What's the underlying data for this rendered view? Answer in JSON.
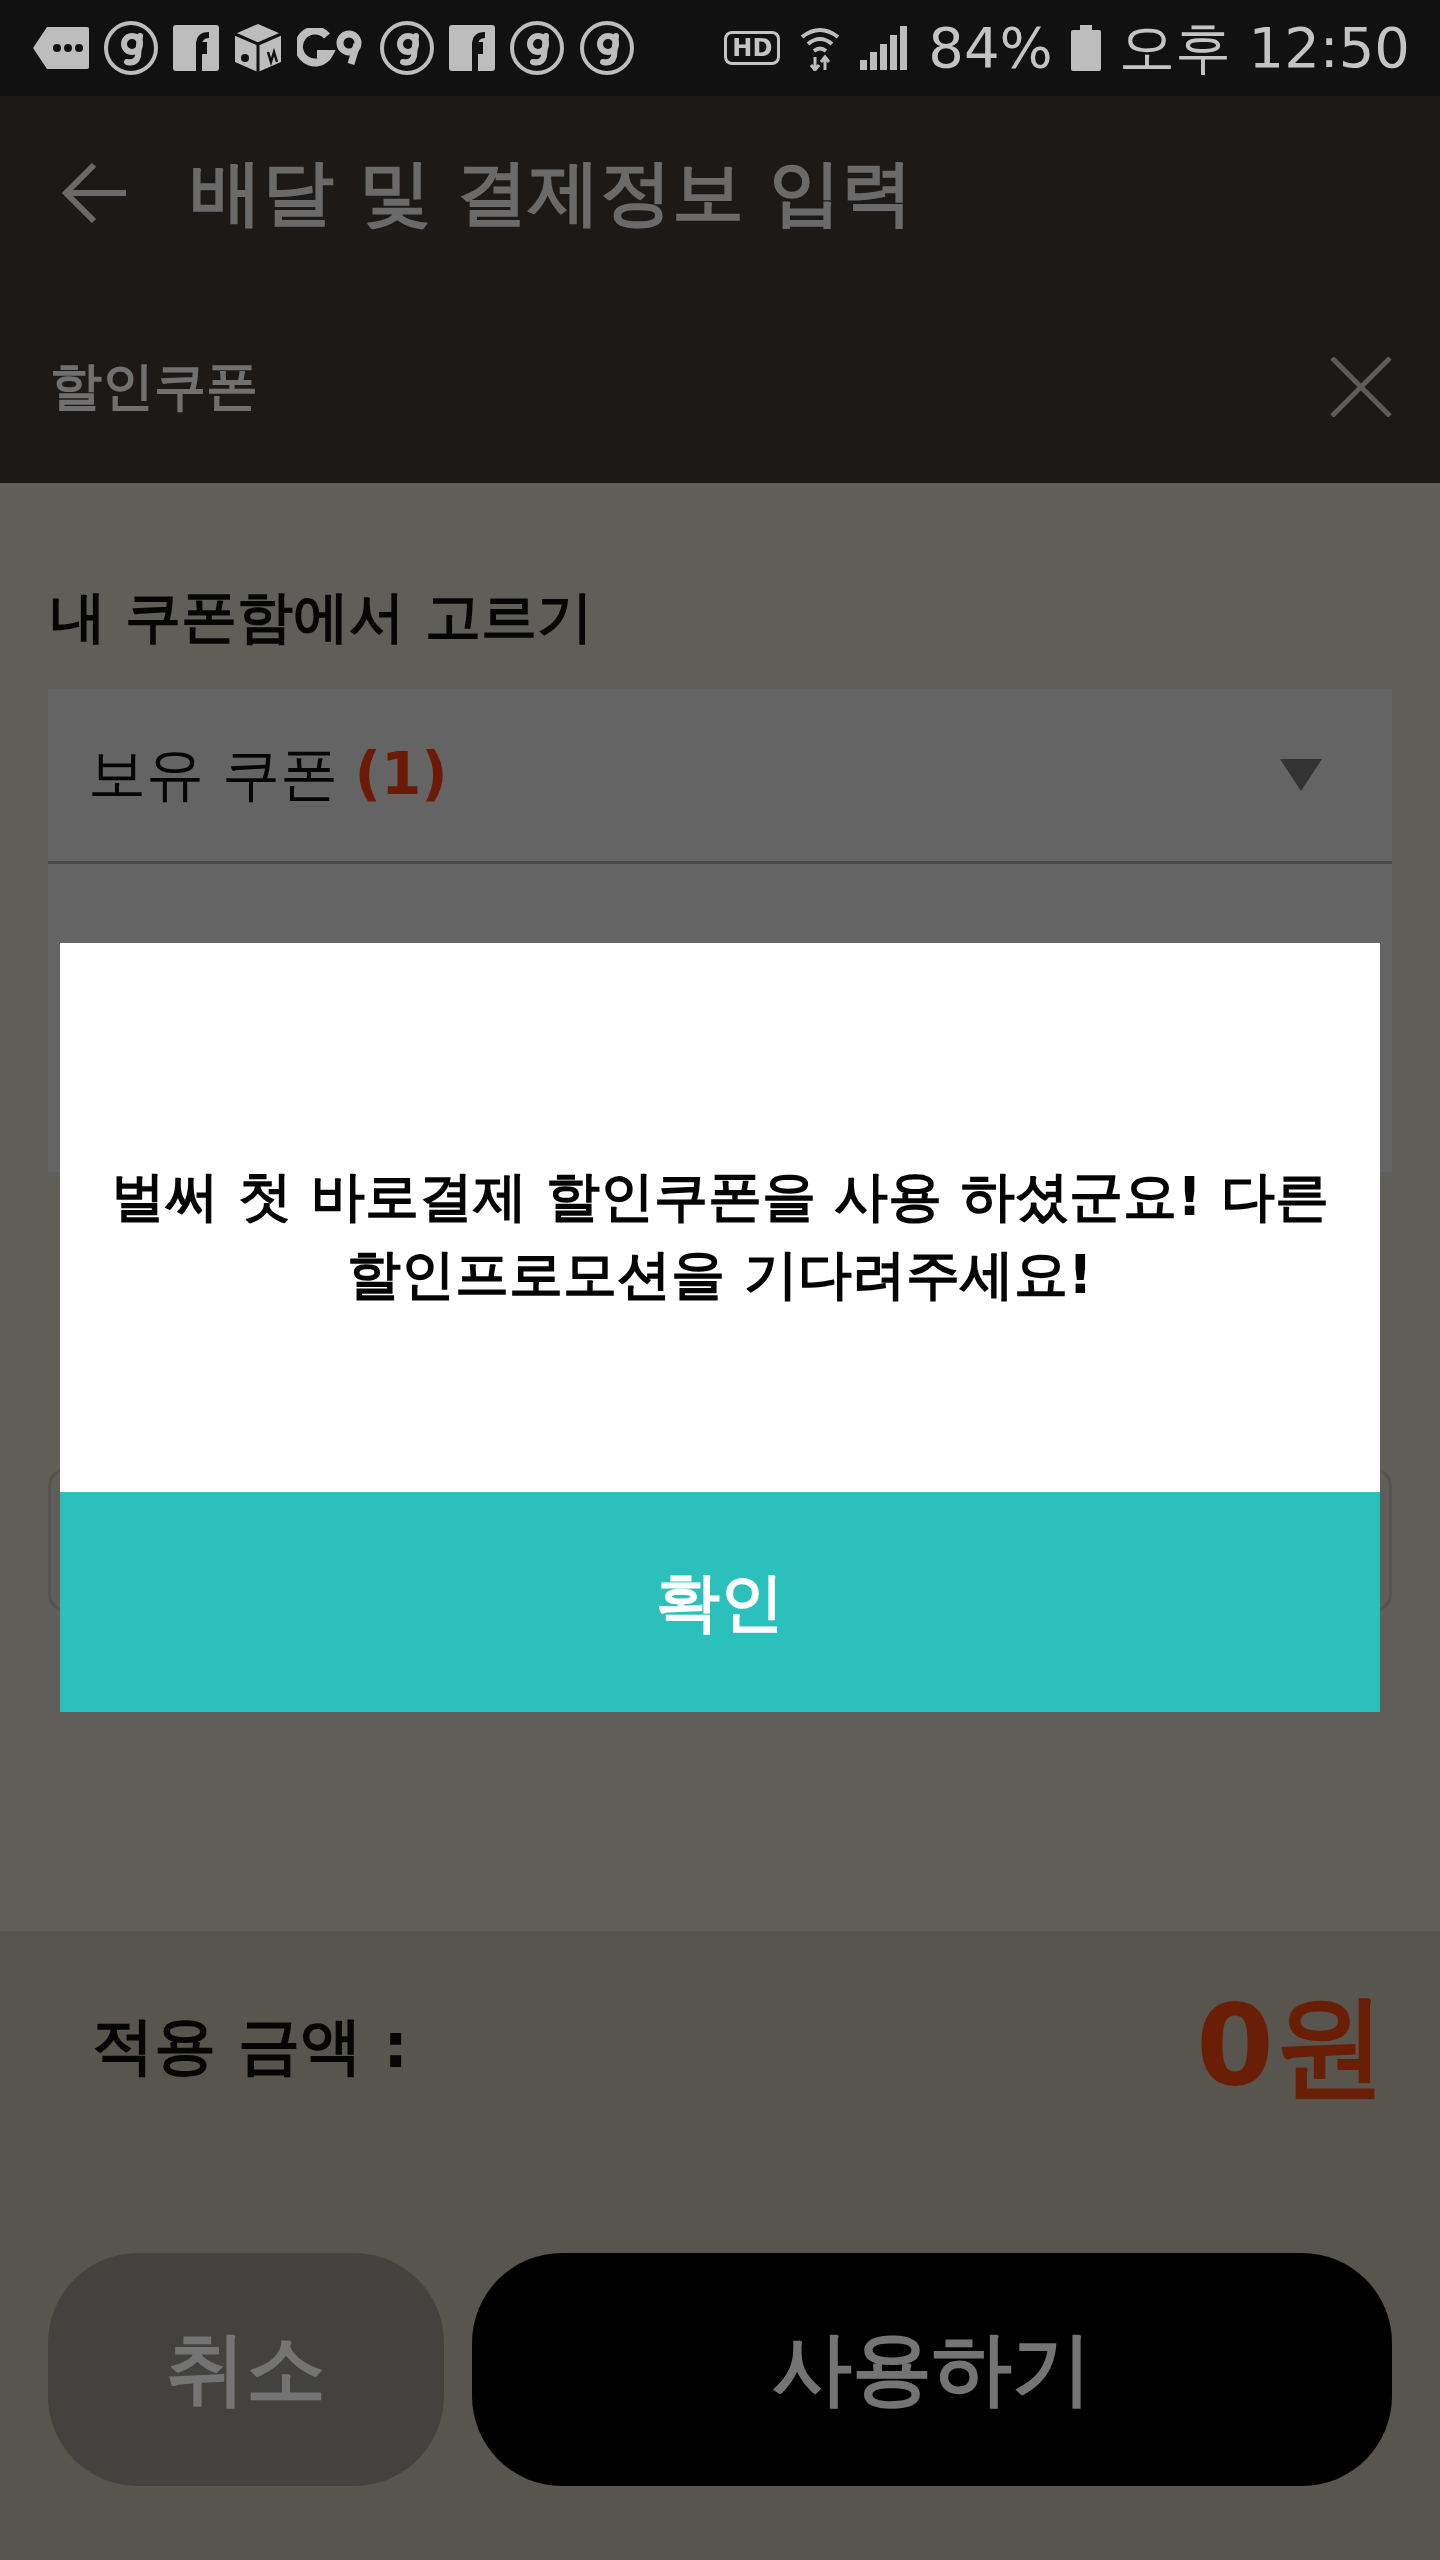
{
  "status_bar": {
    "hd": "HD",
    "battery": "84%",
    "time": "오후 12:50"
  },
  "app_bar": {
    "title": "배달 및 결제정보 입력"
  },
  "coupon_sheet": {
    "title": "할인쿠폰",
    "section_label": "내 쿠폰함에서 고르기",
    "coupon_select": {
      "label": "보유 쿠폰",
      "count": "(1)"
    }
  },
  "summary": {
    "label": "적용 금액 :",
    "amount": "0원"
  },
  "buttons": [
    {
      "label": "취소",
      "kind": "secondary"
    },
    {
      "label": "사용하기",
      "kind": "primary"
    }
  ],
  "dialog": {
    "message": "벌써 첫 바로결제 할인쿠폰을 사용 하셨군요! 다른 할인프로모션을 기다려주세요!",
    "confirm": "확인"
  }
}
